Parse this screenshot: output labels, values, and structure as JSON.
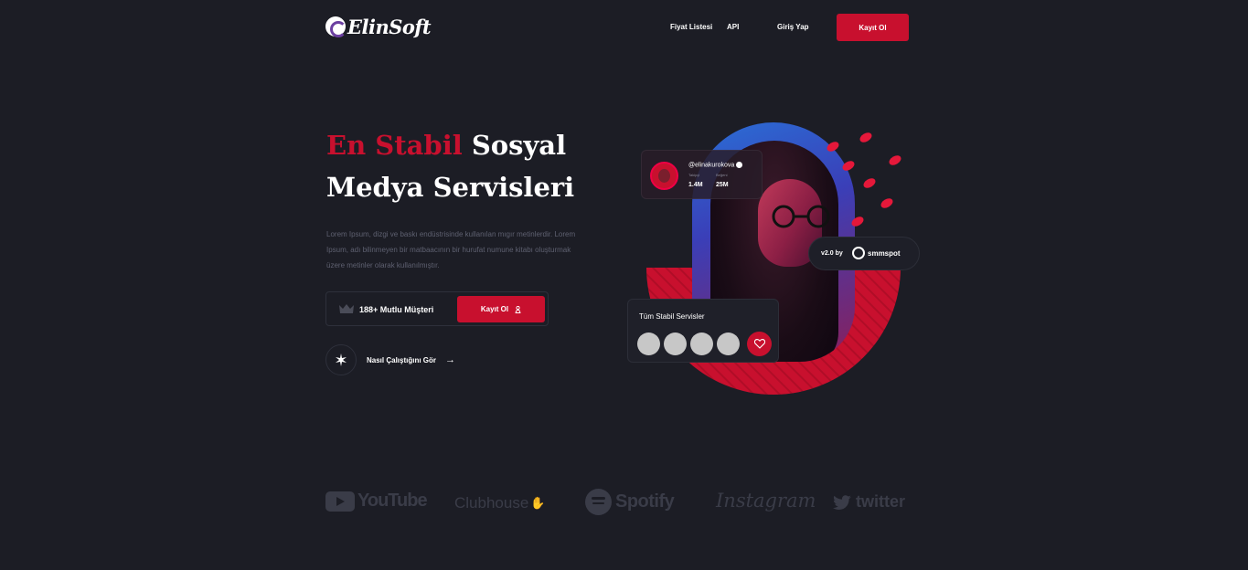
{
  "nav": {
    "logo_text": "ElinSoft",
    "links": [
      "Fiyat Listesi",
      "API",
      "Giriş Yap"
    ],
    "signup": "Kayıt Ol"
  },
  "hero": {
    "title_accent": "En Stabil",
    "title_rest": "Sosyal Medya Servisleri",
    "description": "Lorem Ipsum, dizgi ve baskı endüstrisinde kullanılan mıgır metinlerdir. Lorem Ipsum, adı bilinmeyen bir matbaacının bir hurufat numune kitabı oluşturmak üzere metinler olarak kullanılmıştır.",
    "customers": "188+ Mutlu Müşteri",
    "cta": "Kayıt Ol",
    "how_it_works": "Nasıl Çalıştığını Gör"
  },
  "profile": {
    "handle": "@elinakurokova",
    "followers_label": "Takipçi",
    "followers": "1.4M",
    "likes_label": "Beğeni",
    "likes": "25M"
  },
  "partner": {
    "version": "v2.0 by",
    "name": "smmspot"
  },
  "services": {
    "title": "Tüm Stabil Servisler"
  },
  "brands": [
    "YouTube",
    "Clubhouse",
    "Spotify",
    "Instagram",
    "twitter"
  ],
  "colors": {
    "background": "#1c1d25",
    "accent": "#c8102e"
  }
}
